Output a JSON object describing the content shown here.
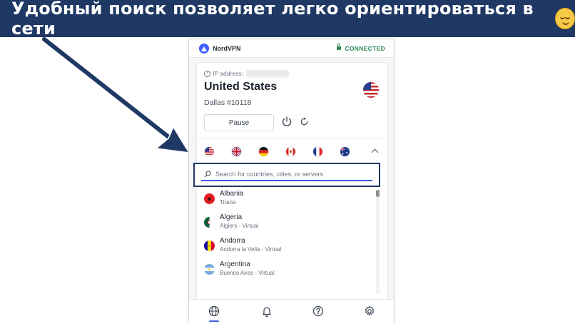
{
  "banner": {
    "text": "Удобный поиск позволяет легко ориентироваться в сети",
    "emoji": "relieved-face-emoji",
    "background": "#1f3864"
  },
  "app": {
    "brand": "NordVPN",
    "status": "CONNECTED",
    "status_color": "#2e8b57",
    "ip_label": "IP address:",
    "country": "United States",
    "server": "Dallas #10118",
    "pause_label": "Pause",
    "quick_flags": [
      "us-flag",
      "uk-flag",
      "germany-flag",
      "canada-flag",
      "france-flag",
      "australia-flag"
    ],
    "search": {
      "placeholder": "Search for countries, cities, or servers",
      "value": ""
    },
    "countries": [
      {
        "name": "Albania",
        "city": "Tirana",
        "flag": "albania-flag"
      },
      {
        "name": "Algeria",
        "city": "Algiers - Virtual",
        "flag": "algeria-flag"
      },
      {
        "name": "Andorra",
        "city": "Andorra la Vella - Virtual",
        "flag": "andorra-flag"
      },
      {
        "name": "Argentina",
        "city": "Buenos Aires - Virtual",
        "flag": "argentina-flag"
      }
    ],
    "nav": [
      "globe-icon",
      "bell-icon",
      "help-icon",
      "gear-icon"
    ],
    "accent": "#3b5bdb"
  }
}
